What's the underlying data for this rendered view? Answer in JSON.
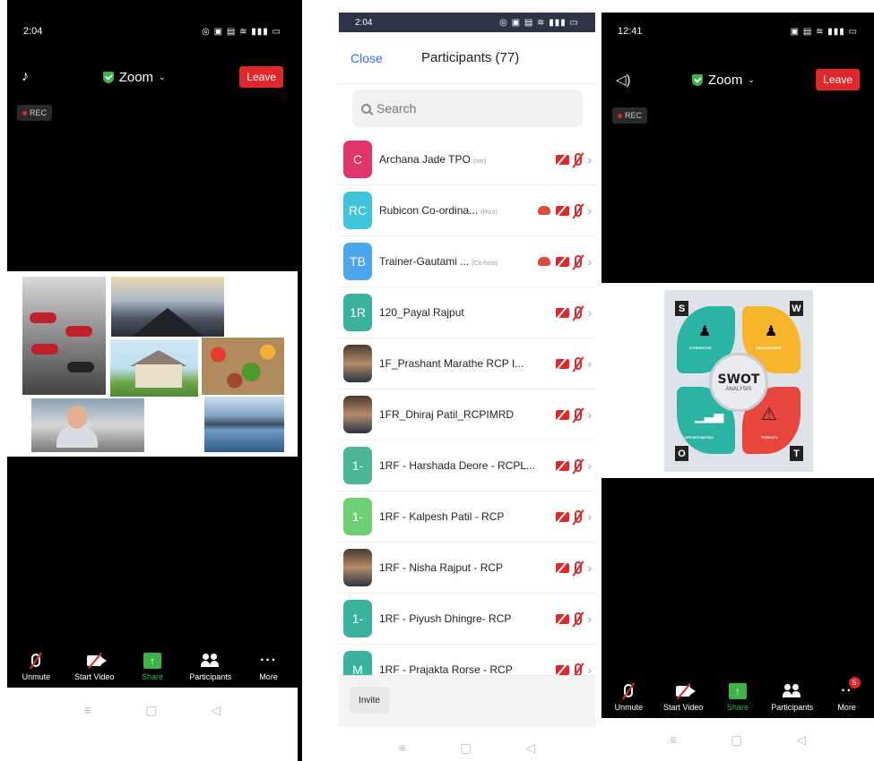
{
  "panel1": {
    "status_time": "2:04",
    "meeting_title": "Zoom",
    "leave_label": "Leave",
    "rec_label": "REC",
    "toolbar": {
      "unmute": "Unmute",
      "start_video": "Start Video",
      "share": "Share",
      "participants": "Participants",
      "more": "More"
    }
  },
  "panel2": {
    "status_time": "2:04",
    "close_label": "Close",
    "title": "Participants (77)",
    "search_placeholder": "Search",
    "invite_label": "Invite",
    "participants": [
      {
        "initials": "C",
        "name": "Archana Jade TPO",
        "role": "(me)",
        "color": "#e2336b",
        "photo": false,
        "cloud": false
      },
      {
        "initials": "RC",
        "name": "Rubicon Co-ordina...",
        "role": "(Host)",
        "color": "#3fc4dd",
        "photo": false,
        "cloud": true
      },
      {
        "initials": "TB",
        "name": "Trainer-Gautami ...",
        "role": "(Co-host)",
        "color": "#4aa7ee",
        "photo": false,
        "cloud": true
      },
      {
        "initials": "1R",
        "name": "120_Payal Rajput",
        "role": "",
        "color": "#3ab39e",
        "photo": false,
        "cloud": false
      },
      {
        "initials": "",
        "name": "1F_Prashant Marathe RCP I...",
        "role": "",
        "color": "#6b4e3a",
        "photo": true,
        "cloud": false
      },
      {
        "initials": "",
        "name": "1FR_Dhiraj Patil_RCPIMRD",
        "role": "",
        "color": "#6b4e3a",
        "photo": true,
        "cloud": false
      },
      {
        "initials": "1-",
        "name": "1RF - Harshada Deore - RCPL...",
        "role": "",
        "color": "#4bb596",
        "photo": false,
        "cloud": false
      },
      {
        "initials": "1-",
        "name": "1RF - Kalpesh Patil - RCP",
        "role": "",
        "color": "#6fcf74",
        "photo": false,
        "cloud": false
      },
      {
        "initials": "",
        "name": "1RF - Nisha Rajput - RCP",
        "role": "",
        "color": "#8a6b3a",
        "photo": true,
        "cloud": false
      },
      {
        "initials": "1-",
        "name": "1RF - Piyush Dhingre- RCP",
        "role": "",
        "color": "#3ab39e",
        "photo": false,
        "cloud": false
      },
      {
        "initials": "M",
        "name": "1RF - Prajakta Rorse - RCP",
        "role": "",
        "color": "#3ab39e",
        "photo": false,
        "cloud": false
      }
    ]
  },
  "panel3": {
    "status_time": "12:41",
    "meeting_title": "Zoom",
    "leave_label": "Leave",
    "rec_label": "REC",
    "swot": {
      "main": "SWOT",
      "sub": "ANALYSIS",
      "s": "S",
      "w": "W",
      "o": "O",
      "t": "T",
      "strengths": "STRENGTHS",
      "weaknesses": "WEAKNESSES",
      "opportunities": "OPPORTUNITIES",
      "threats": "THREATS"
    },
    "more_badge": "5",
    "toolbar": {
      "unmute": "Unmute",
      "start_video": "Start Video",
      "share": "Share",
      "participants": "Participants",
      "more": "More"
    }
  },
  "colors": {
    "leave": "#e0282c",
    "share_green": "#3bb54a",
    "close_blue": "#2d6ef5",
    "swot_teal": "#2bb3a3",
    "swot_yellow": "#f7b52c",
    "swot_red": "#e8453c"
  }
}
